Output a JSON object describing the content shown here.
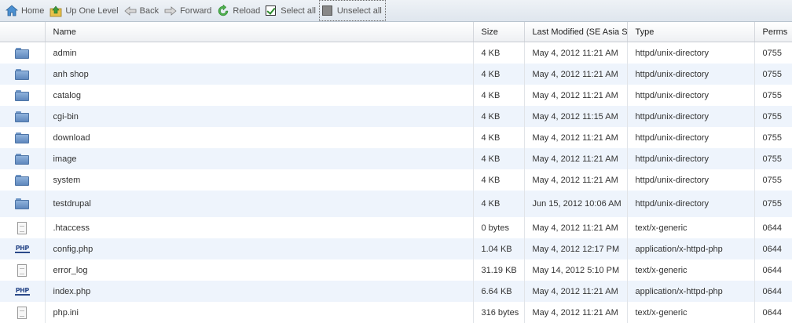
{
  "toolbar": {
    "home": "Home",
    "up": "Up One Level",
    "back": "Back",
    "forward": "Forward",
    "reload": "Reload",
    "select_all": "Select all",
    "unselect_all": "Unselect all"
  },
  "columns": {
    "name": "Name",
    "size": "Size",
    "modified": "Last Modified (SE Asia S",
    "type": "Type",
    "perms": "Perms"
  },
  "rows": [
    {
      "icon": "folder-icon",
      "name": "admin",
      "size": "4 KB",
      "modified": "May 4, 2012 11:21 AM",
      "type": "httpd/unix-directory",
      "perms": "0755"
    },
    {
      "icon": "folder-icon",
      "name": "anh shop",
      "size": "4 KB",
      "modified": "May 4, 2012 11:21 AM",
      "type": "httpd/unix-directory",
      "perms": "0755"
    },
    {
      "icon": "folder-icon",
      "name": "catalog",
      "size": "4 KB",
      "modified": "May 4, 2012 11:21 AM",
      "type": "httpd/unix-directory",
      "perms": "0755"
    },
    {
      "icon": "folder-icon",
      "name": "cgi-bin",
      "size": "4 KB",
      "modified": "May 4, 2012 11:15 AM",
      "type": "httpd/unix-directory",
      "perms": "0755"
    },
    {
      "icon": "folder-icon",
      "name": "download",
      "size": "4 KB",
      "modified": "May 4, 2012 11:21 AM",
      "type": "httpd/unix-directory",
      "perms": "0755"
    },
    {
      "icon": "folder-icon",
      "name": "image",
      "size": "4 KB",
      "modified": "May 4, 2012 11:21 AM",
      "type": "httpd/unix-directory",
      "perms": "0755"
    },
    {
      "icon": "folder-icon",
      "name": "system",
      "size": "4 KB",
      "modified": "May 4, 2012 11:21 AM",
      "type": "httpd/unix-directory",
      "perms": "0755"
    },
    {
      "icon": "folder-icon",
      "name": "testdrupal",
      "size": "4 KB",
      "modified": "Jun 15, 2012 10:06 AM",
      "type": "httpd/unix-directory",
      "perms": "0755"
    },
    {
      "icon": "generic-file-icon",
      "name": ".htaccess",
      "size": "0 bytes",
      "modified": "May 4, 2012 11:21 AM",
      "type": "text/x-generic",
      "perms": "0644"
    },
    {
      "icon": "php-file-icon",
      "name": "config.php",
      "size": "1.04 KB",
      "modified": "May 4, 2012 12:17 PM",
      "type": "application/x-httpd-php",
      "perms": "0644"
    },
    {
      "icon": "generic-file-icon",
      "name": "error_log",
      "size": "31.19 KB",
      "modified": "May 14, 2012 5:10 PM",
      "type": "text/x-generic",
      "perms": "0644"
    },
    {
      "icon": "php-file-icon",
      "name": "index.php",
      "size": "6.64 KB",
      "modified": "May 4, 2012 11:21 AM",
      "type": "application/x-httpd-php",
      "perms": "0644"
    },
    {
      "icon": "generic-file-icon",
      "name": "php.ini",
      "size": "316 bytes",
      "modified": "May 4, 2012 11:21 AM",
      "type": "text/x-generic",
      "perms": "0644"
    }
  ],
  "php_icon_text": "PHP"
}
